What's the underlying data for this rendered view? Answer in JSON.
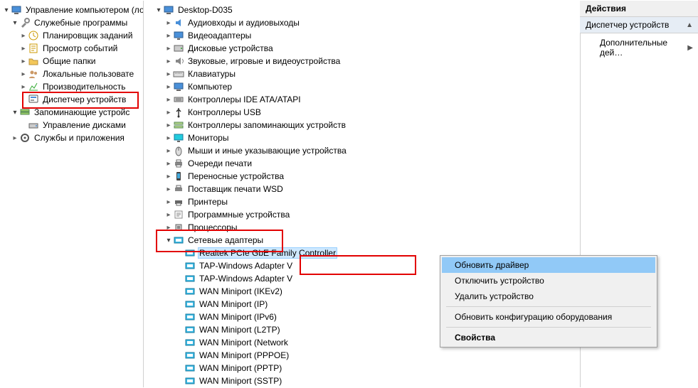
{
  "left_tree": {
    "root": {
      "label": "Управление компьютером (ло",
      "icon": "computer",
      "caret": "open",
      "indent": 0
    },
    "services_root": {
      "label": "Служебные программы",
      "icon": "tools",
      "caret": "open",
      "indent": 1
    },
    "children": [
      {
        "label": "Планировщик заданий",
        "icon": "clock",
        "caret": "closed",
        "indent": 2
      },
      {
        "label": "Просмотр событий",
        "icon": "event",
        "caret": "closed",
        "indent": 2
      },
      {
        "label": "Общие папки",
        "icon": "folder-share",
        "caret": "closed",
        "indent": 2
      },
      {
        "label": "Локальные пользовате",
        "icon": "users",
        "caret": "closed",
        "indent": 2
      },
      {
        "label": "Производительность",
        "icon": "perf",
        "caret": "closed",
        "indent": 2
      }
    ],
    "device_mgr": {
      "label": "Диспетчер устройств",
      "icon": "devmgr",
      "caret": "none",
      "indent": 2,
      "highlight": true
    },
    "storage_root": {
      "label": "Запоминающие устройс",
      "icon": "storage",
      "caret": "open",
      "indent": 1
    },
    "disk_mgr": {
      "label": "Управление дисками",
      "icon": "disk",
      "caret": "none",
      "indent": 2
    },
    "svc_apps": {
      "label": "Службы и приложения",
      "icon": "services",
      "caret": "closed",
      "indent": 1
    }
  },
  "mid_tree": {
    "root": {
      "label": "Desktop-D035",
      "icon": "desktop",
      "caret": "open",
      "indent": 0
    },
    "cats": [
      {
        "label": "Аудиовходы и аудиовыходы",
        "icon": "audio",
        "caret": "closed"
      },
      {
        "label": "Видеоадаптеры",
        "icon": "display",
        "caret": "closed"
      },
      {
        "label": "Дисковые устройства",
        "icon": "hdd",
        "caret": "closed"
      },
      {
        "label": "Звуковые, игровые и видеоустройства",
        "icon": "sound",
        "caret": "closed"
      },
      {
        "label": "Клавиатуры",
        "icon": "keyboard",
        "caret": "closed"
      },
      {
        "label": "Компьютер",
        "icon": "computer2",
        "caret": "closed"
      },
      {
        "label": "Контроллеры IDE ATA/ATAPI",
        "icon": "ide",
        "caret": "closed"
      },
      {
        "label": "Контроллеры USB",
        "icon": "usb",
        "caret": "closed"
      },
      {
        "label": "Контроллеры запоминающих устройств",
        "icon": "storage2",
        "caret": "closed"
      },
      {
        "label": "Мониторы",
        "icon": "monitor",
        "caret": "closed"
      },
      {
        "label": "Мыши и иные указывающие устройства",
        "icon": "mouse",
        "caret": "closed"
      },
      {
        "label": "Очереди печати",
        "icon": "printer",
        "caret": "closed"
      },
      {
        "label": "Переносные устройства",
        "icon": "portable",
        "caret": "closed"
      },
      {
        "label": "Поставщик печати WSD",
        "icon": "printer2",
        "caret": "closed"
      },
      {
        "label": "Принтеры",
        "icon": "printer3",
        "caret": "closed"
      },
      {
        "label": "Программные устройства",
        "icon": "software",
        "caret": "closed"
      },
      {
        "label": "Процессоры",
        "icon": "cpu",
        "caret": "closed"
      }
    ],
    "net_root": {
      "label": "Сетевые адаптеры",
      "icon": "net",
      "caret": "open"
    },
    "net_children": [
      {
        "label": "Realtek PCIe GbE Family Controller",
        "icon": "net-dev",
        "selected": true
      },
      {
        "label": "TAP-Windows Adapter V",
        "icon": "net-dev"
      },
      {
        "label": "TAP-Windows Adapter V",
        "icon": "net-dev"
      },
      {
        "label": "WAN Miniport (IKEv2)",
        "icon": "net-dev"
      },
      {
        "label": "WAN Miniport (IP)",
        "icon": "net-dev"
      },
      {
        "label": "WAN Miniport (IPv6)",
        "icon": "net-dev"
      },
      {
        "label": "WAN Miniport (L2TP)",
        "icon": "net-dev"
      },
      {
        "label": "WAN Miniport (Network",
        "icon": "net-dev"
      },
      {
        "label": "WAN Miniport (PPPOE)",
        "icon": "net-dev"
      },
      {
        "label": "WAN Miniport (PPTP)",
        "icon": "net-dev"
      },
      {
        "label": "WAN Miniport (SSTP)",
        "icon": "net-dev"
      }
    ]
  },
  "context_menu": {
    "items": [
      {
        "label": "Обновить драйвер",
        "hl": true
      },
      {
        "label": "Отключить устройство"
      },
      {
        "label": "Удалить устройство"
      },
      {
        "sep": true
      },
      {
        "label": "Обновить конфигурацию оборудования"
      },
      {
        "sep": true
      },
      {
        "label": "Свойства",
        "bold": true
      }
    ]
  },
  "actions": {
    "header": "Действия",
    "section": "Диспетчер устройств",
    "item1": "Дополнительные дей…"
  }
}
